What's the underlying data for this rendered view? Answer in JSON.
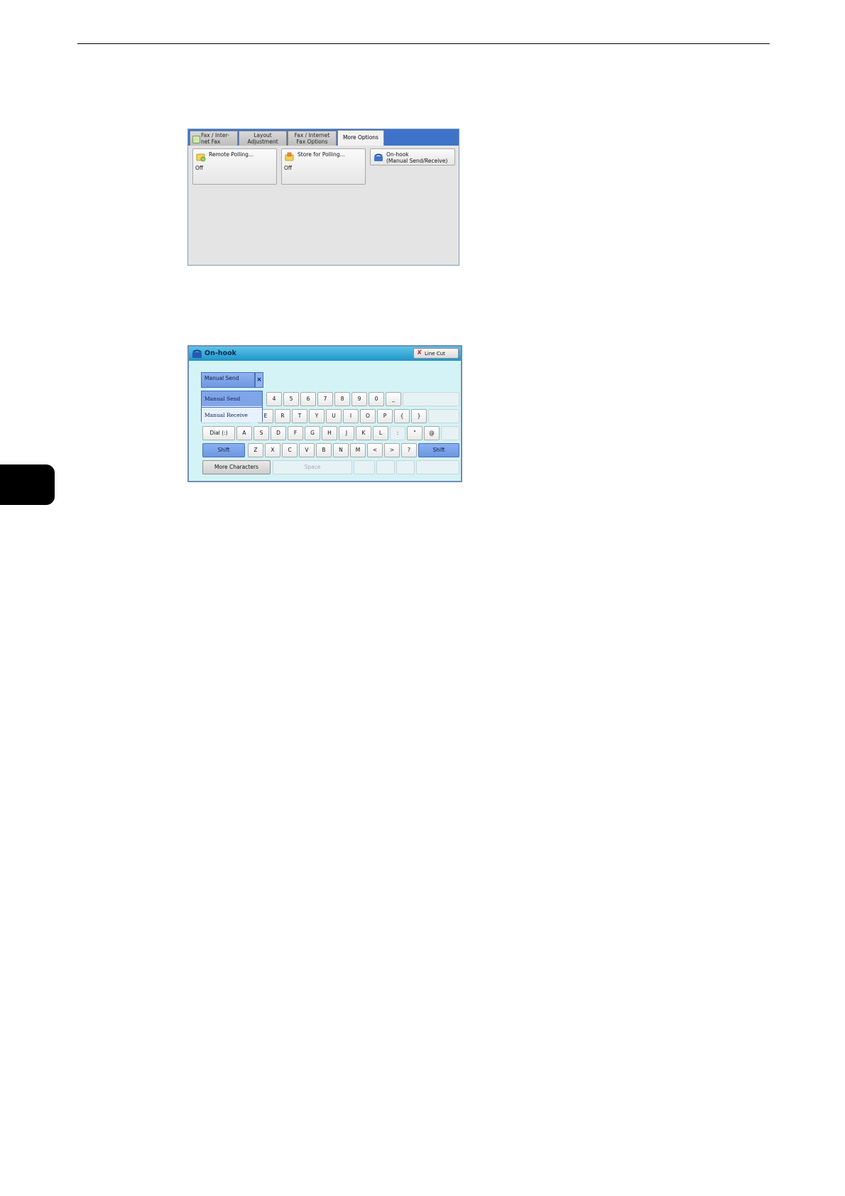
{
  "screen1": {
    "tabs": [
      {
        "label": "Fax / Inter-\nnet Fax",
        "active": false,
        "icon": "fax-icon"
      },
      {
        "label": "Layout\nAdjustment",
        "active": false
      },
      {
        "label": "Fax / Internet\nFax Options",
        "active": false
      },
      {
        "label": "More Options",
        "active": true
      }
    ],
    "features": [
      {
        "label": "Remote Polling...",
        "value": "Off",
        "icon": "remote-polling-icon"
      },
      {
        "label": "Store for Polling...",
        "value": "Off",
        "icon": "store-for-polling-icon"
      },
      {
        "label": "On-hook\n(Manual Send/Receive)",
        "icon": "phone-icon"
      }
    ]
  },
  "screen2": {
    "title": "On-hook",
    "line_cut_label": "Line Cut",
    "mode_selected": "Manual Send",
    "dropdown_options": [
      "Manual Send",
      "Manual Receive"
    ],
    "keys_row1": [
      "4",
      "5",
      "6",
      "7",
      "8",
      "9",
      "0",
      "_"
    ],
    "keys_row2": [
      "E",
      "R",
      "T",
      "Y",
      "U",
      "I",
      "O",
      "P",
      "{",
      "}"
    ],
    "keys_row3": [
      "A",
      "S",
      "D",
      "F",
      "G",
      "H",
      "J",
      "K",
      "L",
      ":",
      "\"",
      "@"
    ],
    "keys_row4": [
      "Z",
      "X",
      "C",
      "V",
      "B",
      "N",
      "M",
      "<",
      ">",
      "?"
    ],
    "dial_label": "Dial (:)",
    "shift_label": "Shift",
    "more_chars_label": "More Characters",
    "space_label": "Space"
  }
}
